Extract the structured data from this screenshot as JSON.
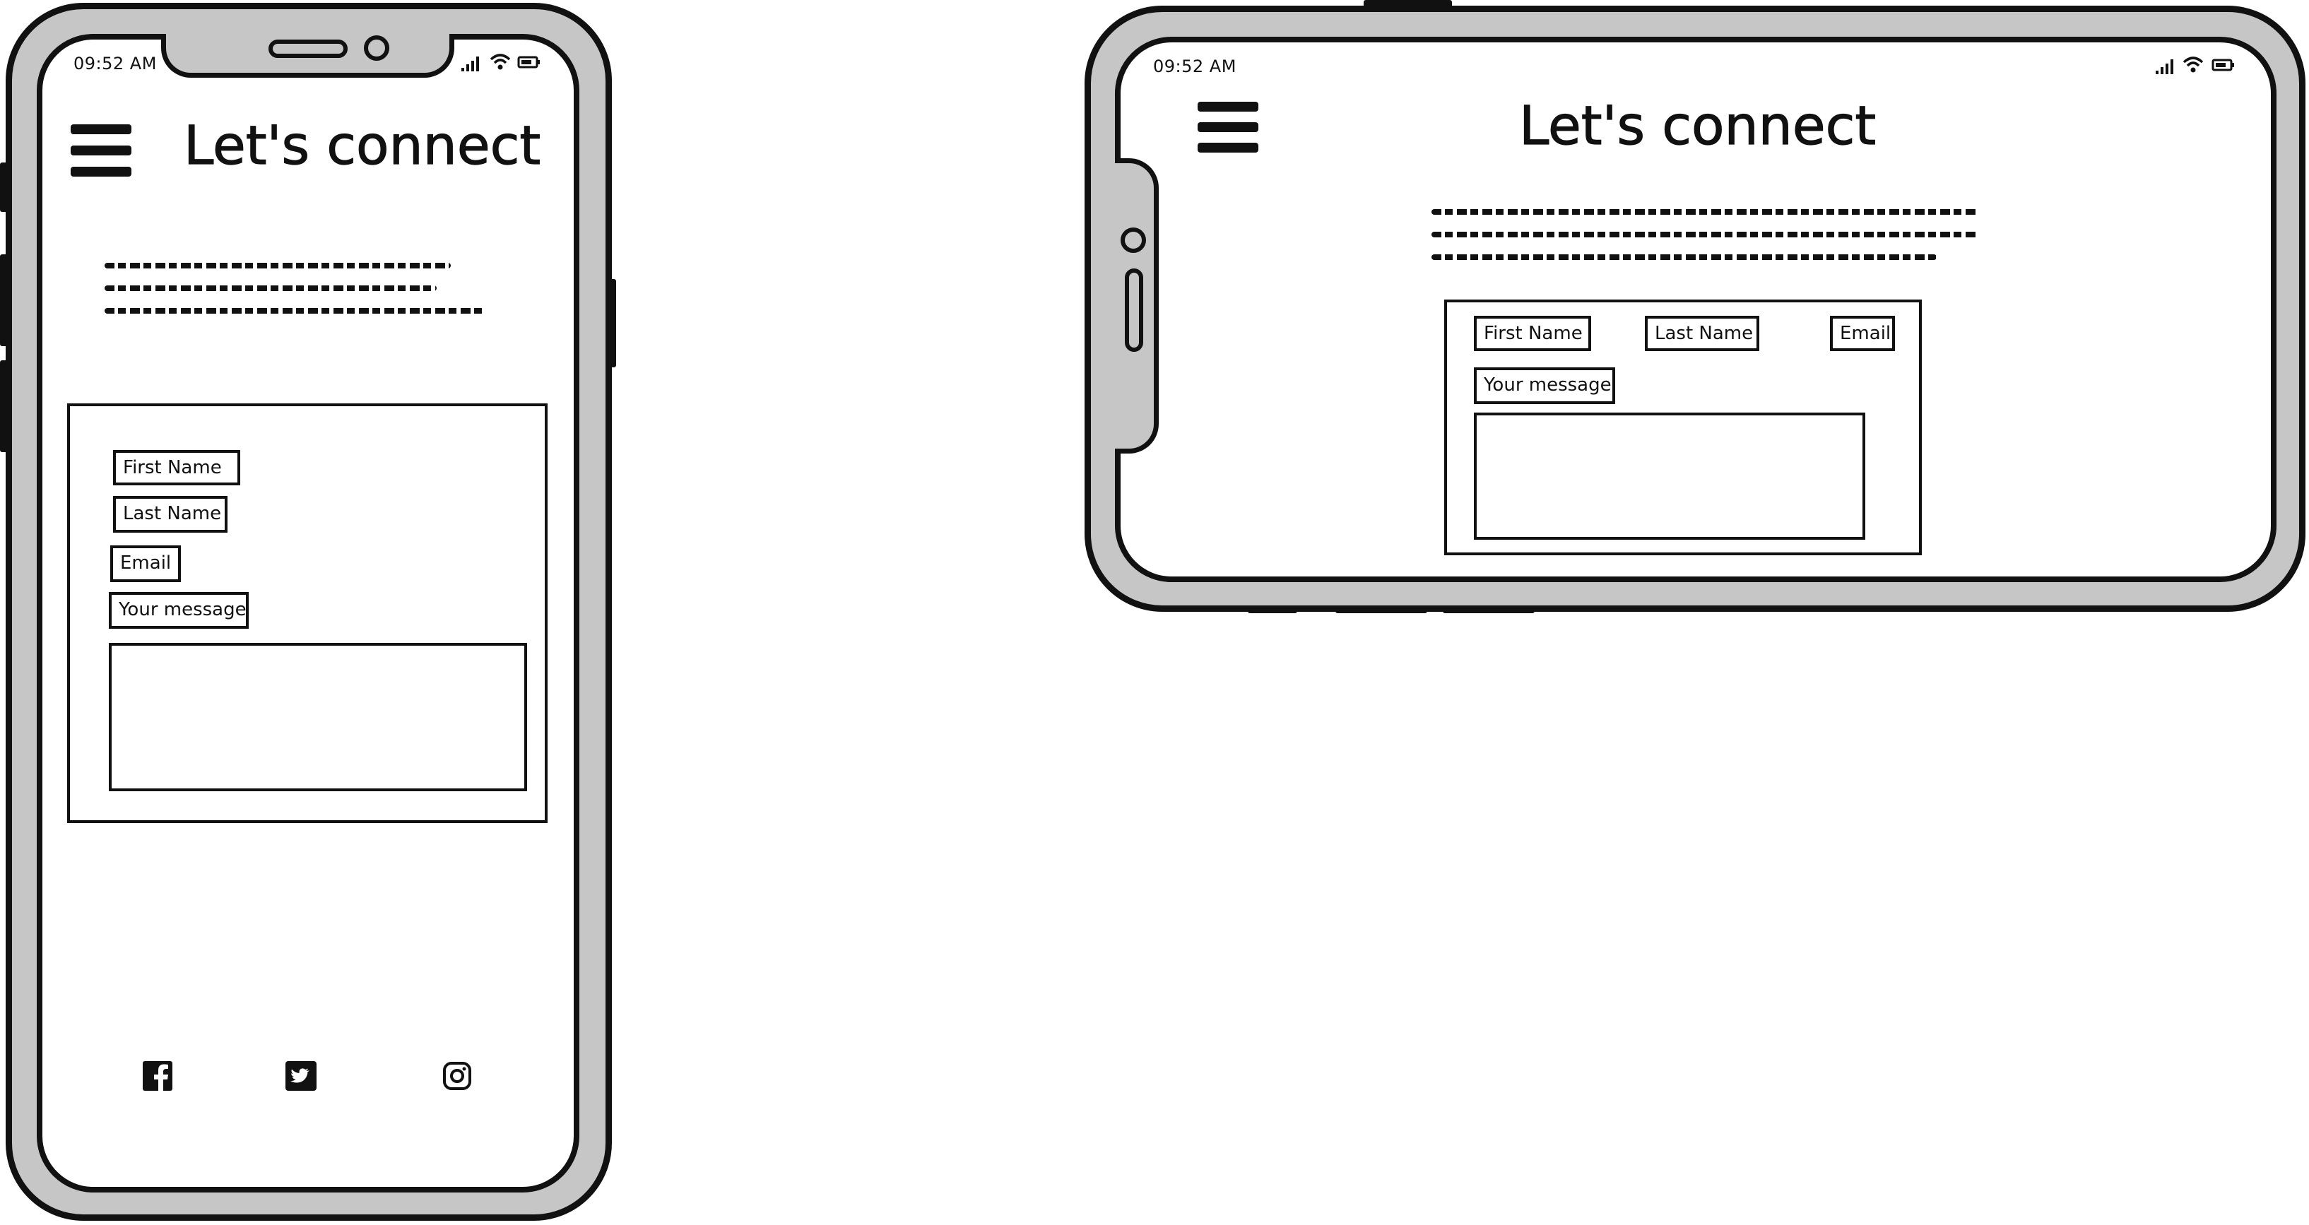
{
  "portrait": {
    "status_bar": {
      "time": "09:52 AM"
    },
    "header": {
      "title": "Let's connect",
      "menu_icon": "hamburger-icon"
    },
    "intro_text_lines": 3,
    "form": {
      "first_name": "First Name",
      "last_name": "Last Name",
      "email": "Email",
      "message_label": "Your message"
    },
    "social": [
      "facebook-icon",
      "twitter-icon",
      "instagram-icon"
    ]
  },
  "landscape": {
    "status_bar": {
      "time": "09:52 AM"
    },
    "header": {
      "title": "Let's connect",
      "menu_icon": "hamburger-icon"
    },
    "intro_text_lines": 3,
    "form": {
      "first_name": "First Name",
      "last_name": "Last Name",
      "email": "Email",
      "message_label": "Your message"
    }
  },
  "colors": {
    "frame": "#c6c6c6",
    "stroke": "#111111",
    "screen": "#ffffff"
  }
}
